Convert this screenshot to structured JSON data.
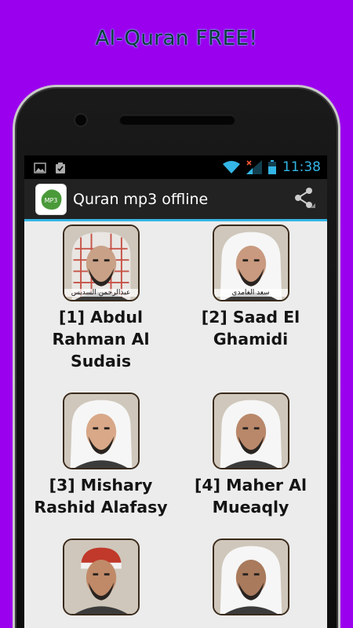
{
  "promo": {
    "title": "Al-Quran FREE!"
  },
  "statusbar": {
    "time": "11:38",
    "icons": [
      "image-icon",
      "clipboard-icon",
      "wifi-icon",
      "signal-icon",
      "battery-icon"
    ]
  },
  "actionbar": {
    "app_icon_text": "MP3",
    "title": "Quran mp3 offline",
    "share_icon": "share-icon"
  },
  "colors": {
    "background": "#9b00ee",
    "accent": "#33b5e5",
    "actionbar": "#222222",
    "content": "#ececec"
  },
  "reciters": [
    {
      "name": "[1] Abdul Rahman Al Sudais",
      "caption": "عبدالرحمن السديس",
      "tone": "#c9a187",
      "headwear": "red-checked"
    },
    {
      "name": "[2] Saad El Ghamidi",
      "caption": "سعد الغامدي",
      "tone": "#c99a7f",
      "headwear": "white"
    },
    {
      "name": "[3] Mishary Rashid Alafasy",
      "caption": "",
      "tone": "#d8a888",
      "headwear": "white"
    },
    {
      "name": "[4] Maher Al Mueaqly",
      "caption": "",
      "tone": "#b9886a",
      "headwear": "white"
    },
    {
      "name": "",
      "caption": "",
      "tone": "#c08a68",
      "headwear": "red-cap"
    },
    {
      "name": "",
      "caption": "",
      "tone": "#a97a5c",
      "headwear": "white"
    }
  ]
}
